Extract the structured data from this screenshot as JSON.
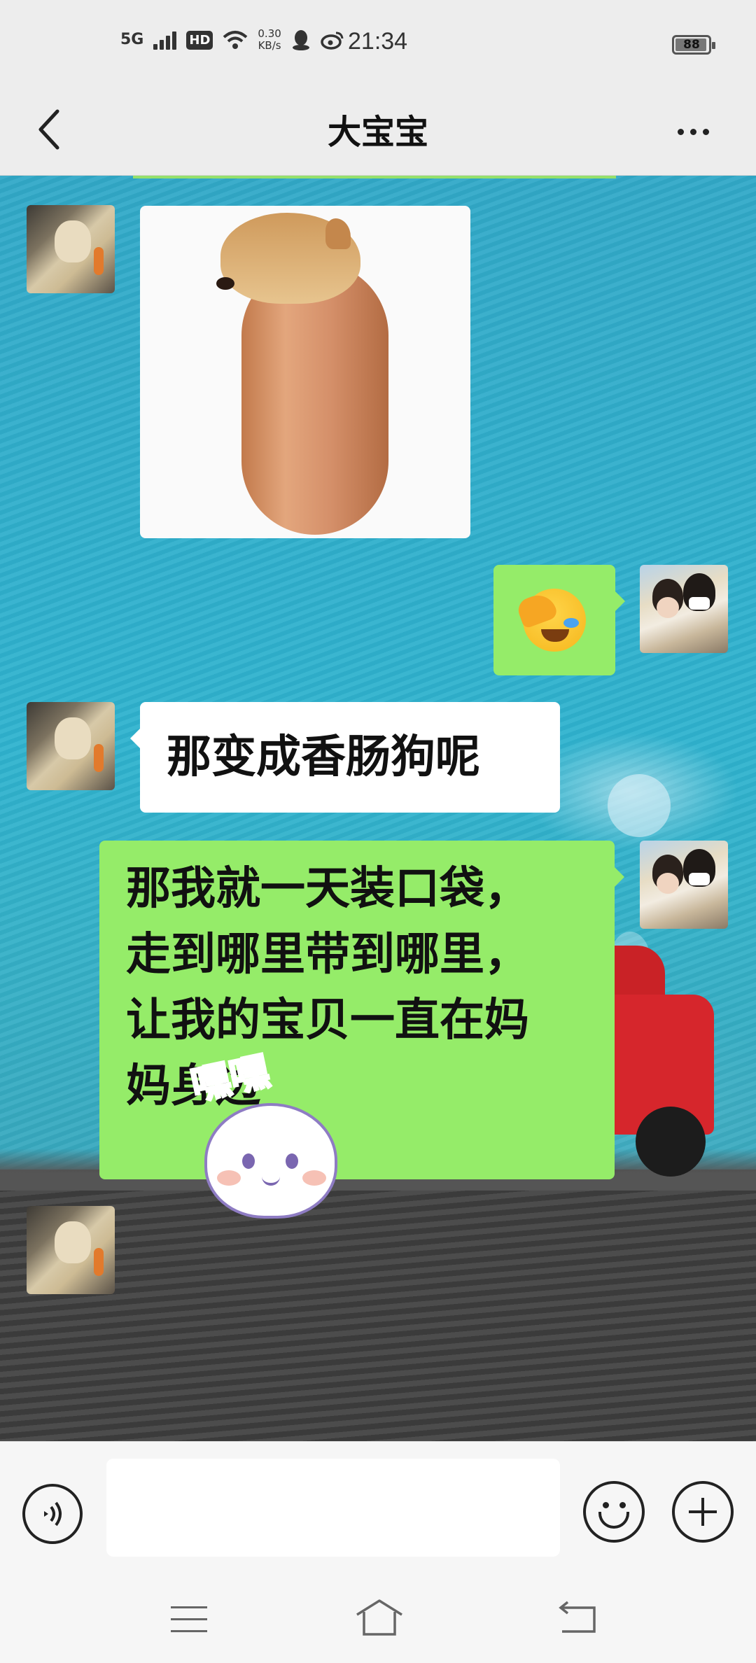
{
  "status_bar": {
    "network": "5G",
    "hd": "HD",
    "speed_value": "0.30",
    "speed_unit": "KB/s",
    "time": "21:34",
    "battery": "88"
  },
  "header": {
    "title": "大宝宝"
  },
  "messages": [
    {
      "side": "left",
      "type": "sticker",
      "sticker": "sausage-dog"
    },
    {
      "side": "right",
      "type": "emoji",
      "emoji": "face-with-hand-crying-laughing"
    },
    {
      "side": "left",
      "type": "text",
      "text": "那变成香肠狗呢"
    },
    {
      "side": "right",
      "type": "text",
      "text": "那我就一天装口袋，\n走到哪里带到哪里，\n让我的宝贝一直在妈\n妈身边"
    },
    {
      "side": "left",
      "type": "sticker",
      "sticker": "hehe-bun",
      "text": "嘿嘿"
    }
  ],
  "input": {
    "value": "",
    "placeholder": ""
  },
  "colors": {
    "bubble_green": "#95ec69",
    "bubble_white": "#ffffff",
    "chrome_bg": "#ededed"
  }
}
